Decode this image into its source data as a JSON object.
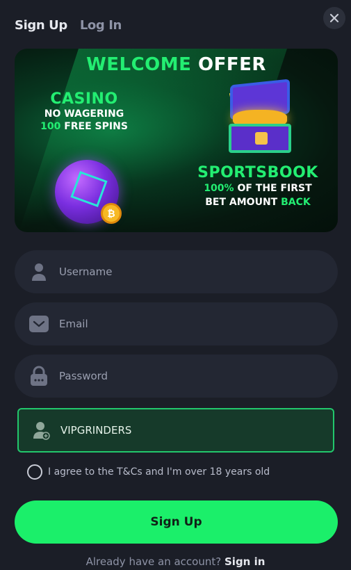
{
  "tabs": {
    "signup": "Sign Up",
    "login": "Log In"
  },
  "close_icon": "close-icon",
  "banner": {
    "title_part1": "WELCOME",
    "title_part2": "OFFER",
    "casino": {
      "heading": "CASINO",
      "line1": "NO WAGERING",
      "line2_num": "100",
      "line2_text": "FREE SPINS"
    },
    "sportsbook": {
      "heading": "SPORTSBOOK",
      "line1_num": "100%",
      "line1_text": "OF THE FIRST",
      "line2_text": "BET AMOUNT",
      "line2_highlight": "BACK"
    },
    "coin_symbol": "₿"
  },
  "form": {
    "username_placeholder": "Username",
    "email_placeholder": "Email",
    "password_placeholder": "Password",
    "promo_value": "VIPGRINDERS",
    "agree_text": "I agree to the T&Cs and I'm over 18 years old",
    "submit_label": "Sign Up"
  },
  "footer": {
    "prompt": "Already have an account?",
    "link": "Sign in"
  },
  "colors": {
    "accent": "#1bef6a",
    "background": "#1b1e27",
    "field": "#232733"
  }
}
